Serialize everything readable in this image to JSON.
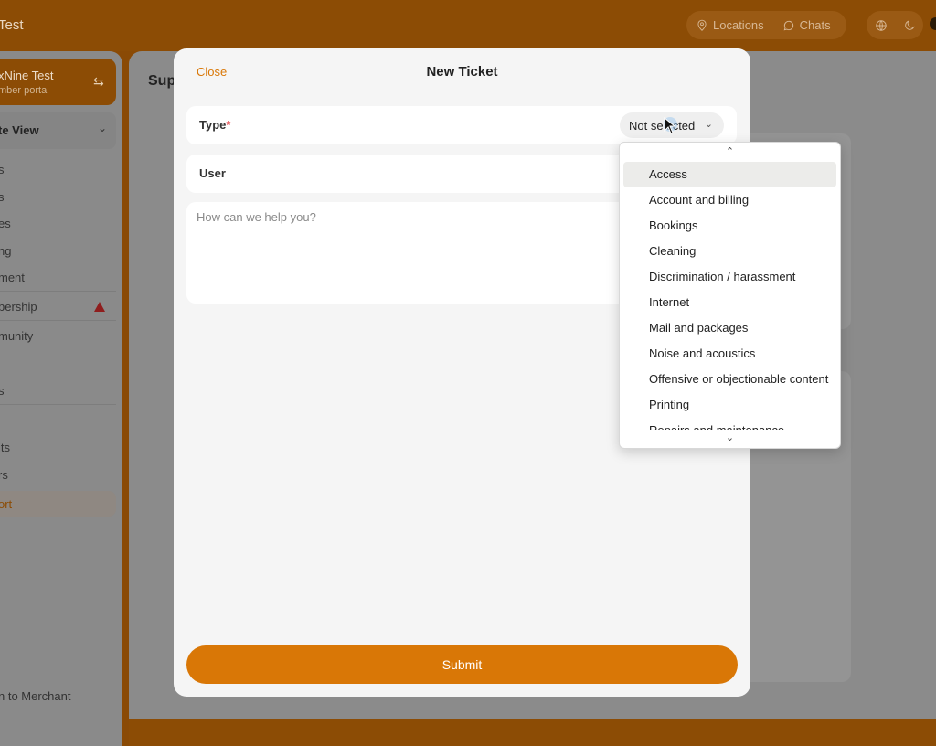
{
  "header": {
    "brand": "Test",
    "nav": [
      {
        "label": "Locations",
        "icon": "location-pin-icon"
      },
      {
        "label": "Chats",
        "icon": "chat-bubble-icon"
      }
    ]
  },
  "sidebar": {
    "org_name": "xNine Test",
    "org_sub": "mber portal",
    "view_label": "te View",
    "items": [
      {
        "label": "s"
      },
      {
        "label": "s"
      },
      {
        "label": "es"
      },
      {
        "label": "ng"
      },
      {
        "label": "ment"
      },
      {
        "label": "bership"
      },
      {
        "label": "munity"
      },
      {
        "label": "s"
      },
      {
        "label": "its"
      },
      {
        "label": "rs"
      },
      {
        "label": "ort"
      }
    ],
    "merchant_link": "n to Merchant"
  },
  "content": {
    "title": "Sup"
  },
  "modal": {
    "close_label": "Close",
    "title": "New Ticket",
    "type_label": "Type",
    "type_required": "*",
    "type_value": "Not selected",
    "user_label": "User",
    "message_placeholder": "How can we help you?",
    "submit_label": "Submit"
  },
  "dropdown": {
    "options": [
      "Access",
      "Account and billing",
      "Bookings",
      "Cleaning",
      "Discrimination / harassment",
      "Internet",
      "Mail and packages",
      "Noise and acoustics",
      "Offensive or objectionable content",
      "Printing",
      "Repairs and maintenance"
    ],
    "highlighted": "Access"
  },
  "colors": {
    "accent": "#d97706",
    "brand_dark": "#8c4c05",
    "required": "#e5484d"
  }
}
